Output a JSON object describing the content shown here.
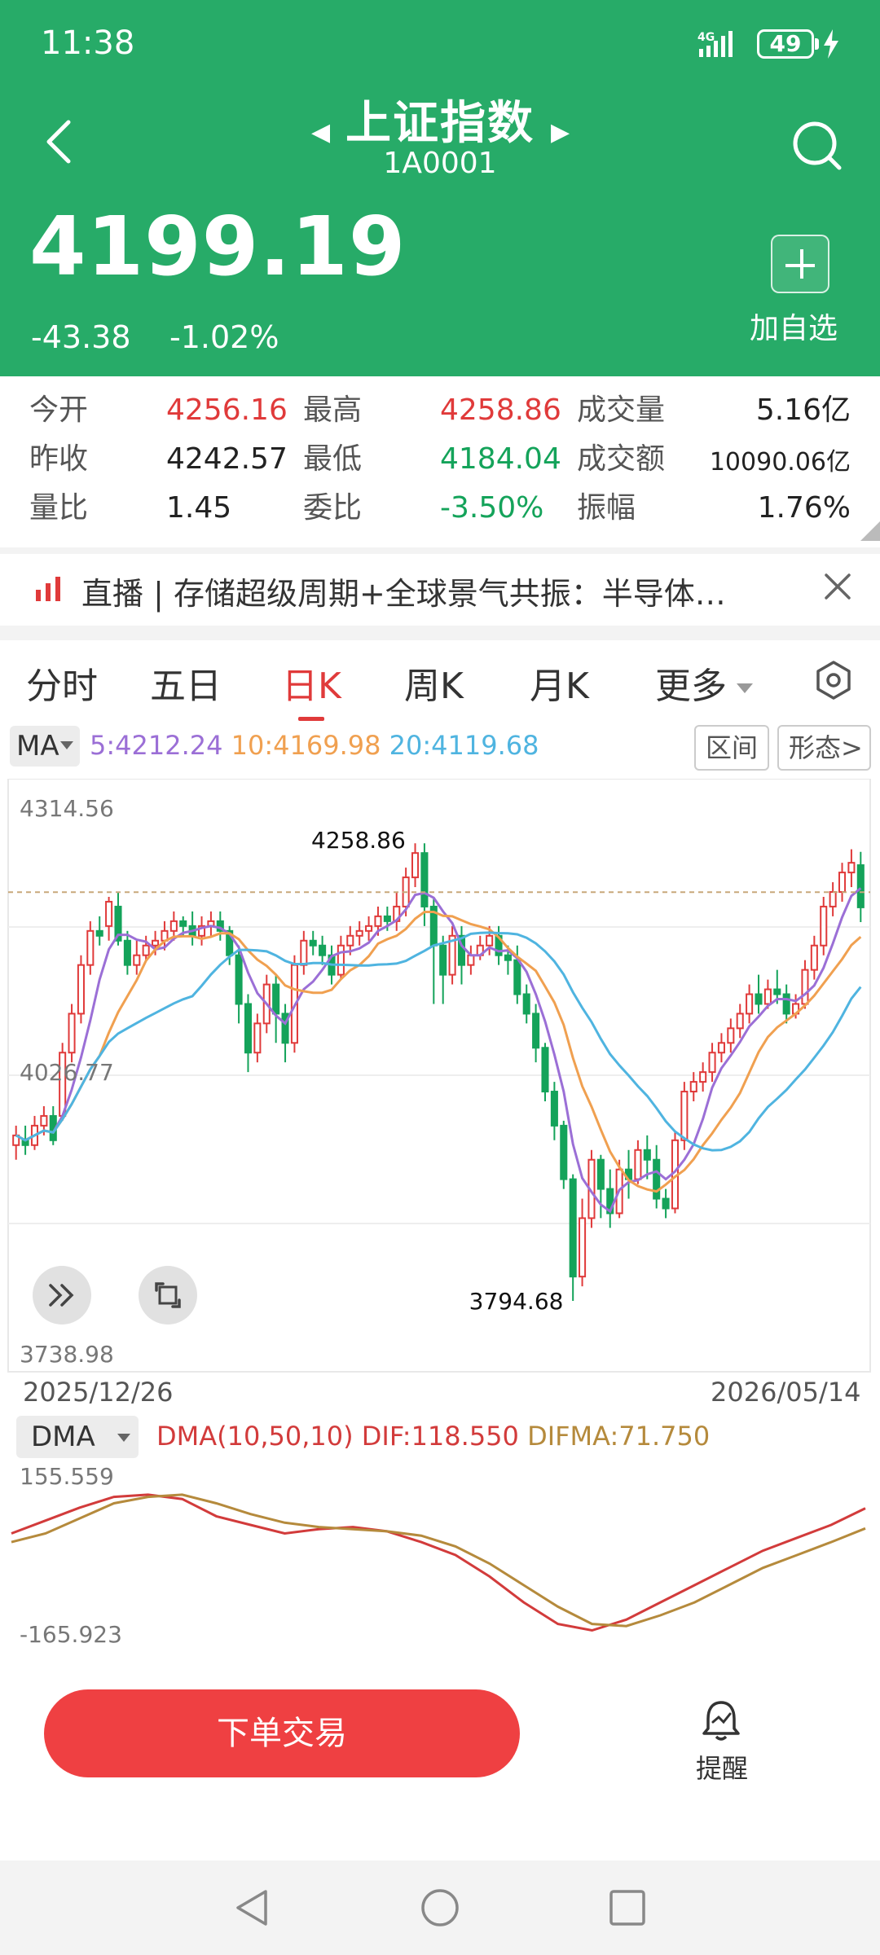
{
  "status_bar": {
    "time": "11:38",
    "battery": "49",
    "network": "4G"
  },
  "header": {
    "title": "上证指数",
    "code": "1A0001",
    "price": "4199.19",
    "change": "-43.38",
    "change_pct": "-1.02%",
    "add_watchlist_label": "加自选"
  },
  "stats": [
    {
      "label": "今开",
      "value": "4256.16",
      "color": "#e03a3a"
    },
    {
      "label": "最高",
      "value": "4258.86",
      "color": "#e03a3a"
    },
    {
      "label": "成交量",
      "value": "5.16亿",
      "color": "#222222"
    },
    {
      "label": "昨收",
      "value": "4242.57",
      "color": "#222222"
    },
    {
      "label": "最低",
      "value": "4184.04",
      "color": "#14a35a"
    },
    {
      "label": "成交额",
      "value": "10090.06亿",
      "color": "#222222"
    },
    {
      "label": "量比",
      "value": "1.45",
      "color": "#222222"
    },
    {
      "label": "委比",
      "value": "-3.50%",
      "color": "#14a35a"
    },
    {
      "label": "振幅",
      "value": "1.76%",
      "color": "#222222"
    }
  ],
  "news": {
    "text": "直播 | 存储超级周期+全球景气共振：半导体…"
  },
  "tabs": [
    "分时",
    "五日",
    "日K",
    "周K",
    "月K",
    "更多"
  ],
  "active_tab": "日K",
  "indicator": {
    "selector": "MA",
    "ma5": "5:4212.24",
    "ma10": "10:4169.98",
    "ma20": "20:4119.68",
    "range_button": "区间",
    "pattern_button": "形态",
    "pattern_caret": ">"
  },
  "chart_data": {
    "type": "candlestick",
    "y_max_label": "4314.56",
    "y_mid_label": "4026.77",
    "y_min_label": "3738.98",
    "ylim": [
      3738.98,
      4314.56
    ],
    "high_label": "4258.86",
    "low_label": "3794.68",
    "x_start": "2025/12/26",
    "x_end": "2026/05/14",
    "colors": {
      "up": "#e03a3a",
      "down": "#14a35a",
      "ma5": "#9b6fd6",
      "ma10": "#f0a050",
      "ma20": "#4fb4e0"
    },
    "candles": [
      [
        3955,
        3965,
        3940,
        3975
      ],
      [
        3960,
        3955,
        3945,
        3975
      ],
      [
        3955,
        3975,
        3950,
        3985
      ],
      [
        3975,
        3985,
        3965,
        3995
      ],
      [
        3985,
        3960,
        3955,
        3995
      ],
      [
        3985,
        4050,
        3980,
        4060
      ],
      [
        4050,
        4090,
        4040,
        4100
      ],
      [
        4090,
        4140,
        4080,
        4150
      ],
      [
        4140,
        4175,
        4130,
        4185
      ],
      [
        4175,
        4170,
        4160,
        4190
      ],
      [
        4180,
        4205,
        4165,
        4210
      ],
      [
        4200,
        4165,
        4160,
        4215
      ],
      [
        4165,
        4140,
        4130,
        4175
      ],
      [
        4140,
        4150,
        4130,
        4165
      ],
      [
        4150,
        4160,
        4145,
        4170
      ],
      [
        4160,
        4165,
        4150,
        4175
      ],
      [
        4165,
        4175,
        4155,
        4185
      ],
      [
        4175,
        4185,
        4165,
        4195
      ],
      [
        4185,
        4180,
        4170,
        4190
      ],
      [
        4180,
        4170,
        4160,
        4195
      ],
      [
        4170,
        4180,
        4160,
        4190
      ],
      [
        4180,
        4185,
        4170,
        4195
      ],
      [
        4185,
        4175,
        4165,
        4195
      ],
      [
        4175,
        4150,
        4140,
        4180
      ],
      [
        4150,
        4100,
        4080,
        4160
      ],
      [
        4100,
        4050,
        4030,
        4110
      ],
      [
        4050,
        4080,
        4040,
        4090
      ],
      [
        4080,
        4120,
        4070,
        4130
      ],
      [
        4120,
        4090,
        4060,
        4130
      ],
      [
        4090,
        4060,
        4040,
        4100
      ],
      [
        4060,
        4140,
        4050,
        4150
      ],
      [
        4140,
        4165,
        4130,
        4175
      ],
      [
        4165,
        4160,
        4150,
        4175
      ],
      [
        4160,
        4150,
        4140,
        4170
      ],
      [
        4150,
        4130,
        4120,
        4160
      ],
      [
        4130,
        4160,
        4125,
        4170
      ],
      [
        4160,
        4170,
        4150,
        4180
      ],
      [
        4170,
        4175,
        4160,
        4185
      ],
      [
        4175,
        4180,
        4165,
        4190
      ],
      [
        4180,
        4190,
        4170,
        4200
      ],
      [
        4190,
        4185,
        4175,
        4200
      ],
      [
        4185,
        4200,
        4175,
        4215
      ],
      [
        4200,
        4230,
        4190,
        4240
      ],
      [
        4230,
        4255,
        4220,
        4265
      ],
      [
        4255,
        4200,
        4180,
        4265
      ],
      [
        4200,
        4160,
        4100,
        4210
      ],
      [
        4160,
        4130,
        4100,
        4170
      ],
      [
        4130,
        4170,
        4120,
        4180
      ],
      [
        4170,
        4140,
        4120,
        4180
      ],
      [
        4140,
        4150,
        4130,
        4160
      ],
      [
        4150,
        4160,
        4145,
        4170
      ],
      [
        4160,
        4170,
        4150,
        4180
      ],
      [
        4170,
        4150,
        4140,
        4180
      ],
      [
        4150,
        4145,
        4130,
        4160
      ],
      [
        4145,
        4110,
        4100,
        4160
      ],
      [
        4110,
        4090,
        4080,
        4120
      ],
      [
        4090,
        4055,
        4040,
        4100
      ],
      [
        4055,
        4010,
        4000,
        4060
      ],
      [
        4010,
        3975,
        3960,
        4020
      ],
      [
        3975,
        3920,
        3910,
        3980
      ],
      [
        3920,
        3820,
        3795,
        3925
      ],
      [
        3820,
        3880,
        3810,
        3900
      ],
      [
        3880,
        3940,
        3870,
        3950
      ],
      [
        3940,
        3910,
        3880,
        3945
      ],
      [
        3910,
        3885,
        3870,
        3930
      ],
      [
        3885,
        3930,
        3880,
        3940
      ],
      [
        3930,
        3920,
        3900,
        3950
      ],
      [
        3920,
        3950,
        3915,
        3960
      ],
      [
        3950,
        3940,
        3920,
        3965
      ],
      [
        3940,
        3900,
        3890,
        3955
      ],
      [
        3900,
        3890,
        3880,
        3910
      ],
      [
        3890,
        3960,
        3885,
        3970
      ],
      [
        3960,
        4010,
        3950,
        4020
      ],
      [
        4010,
        4020,
        4000,
        4030
      ],
      [
        4020,
        4030,
        4010,
        4040
      ],
      [
        4030,
        4050,
        4020,
        4060
      ],
      [
        4050,
        4060,
        4040,
        4070
      ],
      [
        4060,
        4075,
        4050,
        4085
      ],
      [
        4075,
        4090,
        4065,
        4100
      ],
      [
        4090,
        4110,
        4080,
        4120
      ],
      [
        4110,
        4100,
        4090,
        4130
      ],
      [
        4100,
        4115,
        4095,
        4125
      ],
      [
        4115,
        4110,
        4100,
        4135
      ],
      [
        4110,
        4090,
        4080,
        4120
      ],
      [
        4090,
        4100,
        4085,
        4110
      ],
      [
        4100,
        4135,
        4095,
        4145
      ],
      [
        4135,
        4160,
        4125,
        4170
      ],
      [
        4160,
        4200,
        4150,
        4210
      ],
      [
        4200,
        4215,
        4190,
        4225
      ],
      [
        4215,
        4235,
        4205,
        4245
      ],
      [
        4235,
        4245,
        4220,
        4258.86
      ],
      [
        4242.57,
        4199.19,
        4184.04,
        4256.16
      ]
    ]
  },
  "dma": {
    "selector": "DMA",
    "title": "DMA(10,50,10)",
    "dif": "DIF:118.550",
    "difma": "DIFMA:71.750",
    "y_max_label": "155.559",
    "y_min_label": "-165.923",
    "ylim": [
      -165.923,
      155.559
    ],
    "colors": {
      "dif": "#d23b3b",
      "difma": "#b58a3c"
    },
    "dif_values": [
      60,
      90,
      120,
      145,
      150,
      140,
      100,
      80,
      60,
      70,
      75,
      65,
      40,
      10,
      -40,
      -100,
      -150,
      -165,
      -140,
      -100,
      -60,
      -20,
      20,
      50,
      80,
      118.55
    ],
    "difma_values": [
      40,
      60,
      95,
      130,
      145,
      150,
      130,
      105,
      85,
      75,
      70,
      65,
      55,
      30,
      -10,
      -60,
      -110,
      -150,
      -155,
      -130,
      -100,
      -60,
      -20,
      10,
      40,
      71.75
    ]
  },
  "bottom": {
    "trade_label": "下单交易",
    "alert_label": "提醒"
  }
}
